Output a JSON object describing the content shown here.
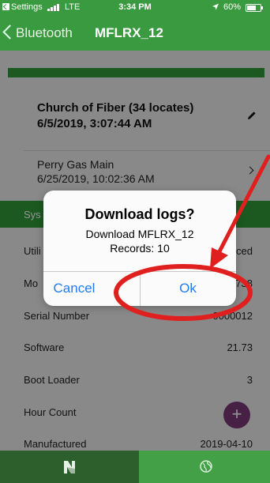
{
  "status_bar": {
    "app_label": "Settings",
    "network": "LTE",
    "time": "3:34 PM",
    "battery": "60%",
    "signal_bars": 4
  },
  "nav": {
    "back_label": "Bluetooth",
    "title": "MFLRX_12"
  },
  "cards": [
    {
      "name": "Church of Fiber (34 locates)",
      "date": "6/5/2019, 3:07:44 AM"
    },
    {
      "name": "Perry Gas Main",
      "date": "6/25/2019, 10:02:36 AM"
    }
  ],
  "section_label": "Sys",
  "properties": [
    {
      "key": "Utili",
      "value": "ced"
    },
    {
      "key": "Mo",
      "value": "738"
    },
    {
      "key": "Serial Number",
      "value": "0000012"
    },
    {
      "key": "Software",
      "value": "21.73"
    },
    {
      "key": "Boot Loader",
      "value": "3"
    },
    {
      "key": "Hour Count",
      "value": ""
    },
    {
      "key": "Manufactured",
      "value": "2019-04-10"
    }
  ],
  "fab_label": "+",
  "dialog": {
    "title": "Download logs?",
    "message_line1": "Download MFLRX_12",
    "message_line2": "Records: 10",
    "cancel_label": "Cancel",
    "ok_label": "Ok"
  },
  "colors": {
    "brand_green": "#3a9a3f",
    "dark_tab": "#2d5f2c",
    "link_blue": "#1f7cf2",
    "annotation_red": "#e0201e",
    "fab_purple": "#7b3a78"
  },
  "tabbar": {
    "items": [
      {
        "icon": "n-logo-icon",
        "active": true
      },
      {
        "icon": "globe-icon",
        "active": false
      }
    ]
  }
}
